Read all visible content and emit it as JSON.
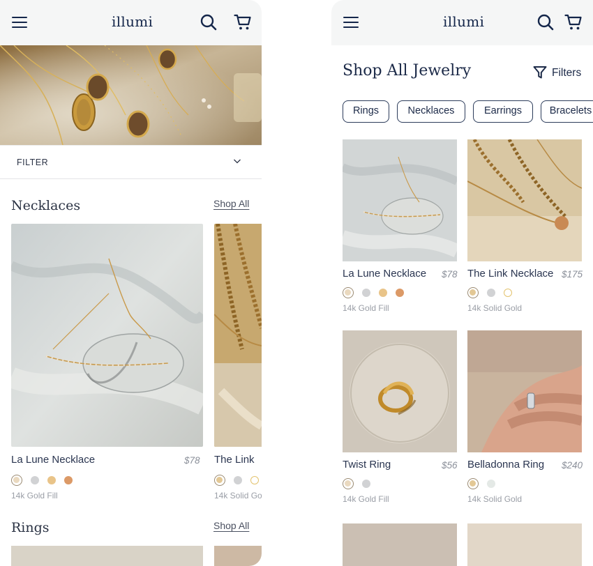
{
  "brand": "illumi",
  "left": {
    "filter_label": "FILTER",
    "sections": [
      {
        "title": "Necklaces",
        "shop_all": "Shop All",
        "products": [
          {
            "name": "La Lune Necklace",
            "price": "$78",
            "material": "14k Gold Fill"
          },
          {
            "name": "The Link",
            "price": "",
            "material": "14k Solid Go"
          }
        ]
      },
      {
        "title": "Rings",
        "shop_all": "Shop All"
      }
    ]
  },
  "right": {
    "page_title": "Shop All Jewelry",
    "filters_label": "Filters",
    "chips": [
      "Rings",
      "Necklaces",
      "Earrings",
      "Bracelets"
    ],
    "products": [
      {
        "name": "La Lune Necklace",
        "price": "$78",
        "material": "14k Gold Fill"
      },
      {
        "name": "The Link Necklace",
        "price": "$175",
        "material": "14k Solid Gold"
      },
      {
        "name": "Twist Ring",
        "price": "$56",
        "material": "14k Gold Fill"
      },
      {
        "name": "Belladonna Ring",
        "price": "$240",
        "material": "14k Solid Gold"
      }
    ]
  },
  "swatch_colors": {
    "gold_fill": "#ead9bf",
    "silver": "#d1d2d4",
    "yellow_gold": "#e9c489",
    "rose_gold": "#dc9a67",
    "solid_gold": "#e3c895",
    "white_gold": "#e4e9e6",
    "gold_outline": "#e3c36e"
  },
  "colors": {
    "navy": "#14264a",
    "header_bg": "#f5f6f6"
  },
  "icons": [
    "menu-icon",
    "search-icon",
    "cart-icon",
    "chevron-down-icon",
    "filter-funnel-icon"
  ]
}
